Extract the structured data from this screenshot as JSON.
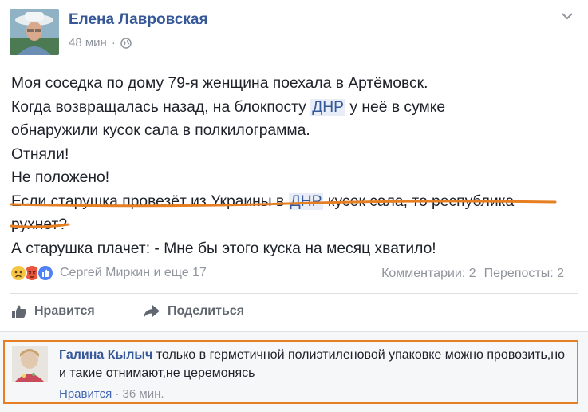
{
  "post": {
    "author": "Елена Лавровская",
    "time": "48 мин",
    "separator": "·",
    "lines": [
      {
        "before": "Моя соседка по дому 79-я женщина поехала в Артёмовск.",
        "hl": "",
        "after": ""
      },
      {
        "before": "Когда возвращалась назад, на блокпосту ",
        "hl": "ДНР",
        "after": " у неё в сумке"
      },
      {
        "before": "обнаружили кусок сала в полкилограмма.",
        "hl": "",
        "after": ""
      },
      {
        "before": "Отняли!",
        "hl": "",
        "after": ""
      },
      {
        "before": "Не положено!",
        "hl": "",
        "after": ""
      },
      {
        "before": "Если старушка провезёт из Украины в ",
        "hl": "ДНР",
        "after": " кусок сала, то республика"
      },
      {
        "before": "рухнет?",
        "hl": "",
        "after": ""
      },
      {
        "before": "А старушка плачет: - Мне бы этого куска на месяц хватило!",
        "hl": "",
        "after": ""
      }
    ]
  },
  "reactions": {
    "names": "Сергей Миркин и еще 17",
    "comments": "Комментарии: 2",
    "shares": "Перепосты: 2",
    "colors": {
      "sad": "#f7c544",
      "angry": "#e9573e",
      "like": "#4e82f6"
    }
  },
  "actions": {
    "like": "Нравится",
    "share": "Поделиться"
  },
  "comment": {
    "author": "Галина Кылыч",
    "text": " только в герметичной полиэтиленовой упаковке можно провозить,но и такие отнимают,не церемонясь",
    "like": "Нравится",
    "separator": "·",
    "time": "36 мин."
  },
  "annotation_color": "#e67e22"
}
